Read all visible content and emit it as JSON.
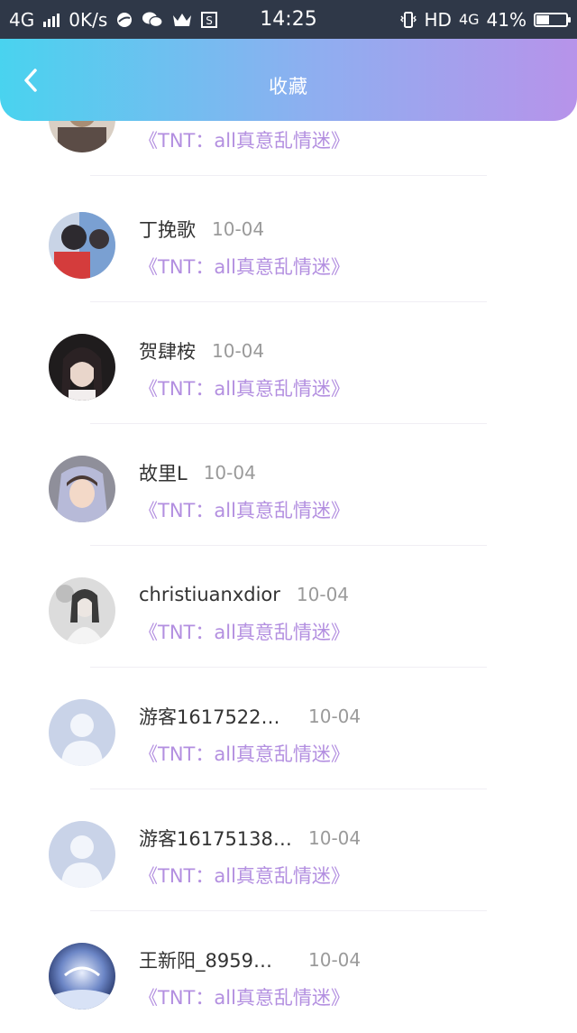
{
  "status_bar": {
    "network": "4G",
    "speed": "0K/s",
    "time": "14:25",
    "hd": "HD",
    "network_right": "4G",
    "battery": "41%",
    "battery_level": 0.41
  },
  "header": {
    "title": "收藏",
    "back_icon": "chevron-left-icon"
  },
  "colors": {
    "header_gradient": [
      "#49d3ef",
      "#8faef0",
      "#b793ea"
    ],
    "book_link": "#b38fe0",
    "name": "#333333",
    "date": "#9a9a9a"
  },
  "items": [
    {
      "name": "",
      "date": "",
      "book": "《TNT：all真意乱情迷》",
      "avatar": "photo-avatar"
    },
    {
      "name": "丁挽歌",
      "date": "10-04",
      "book": "《TNT：all真意乱情迷》",
      "avatar": "photo-avatar"
    },
    {
      "name": "贺肆桉",
      "date": "10-04",
      "book": "《TNT：all真意乱情迷》",
      "avatar": "photo-avatar"
    },
    {
      "name": "故里L",
      "date": "10-04",
      "book": "《TNT：all真意乱情迷》",
      "avatar": "photo-avatar"
    },
    {
      "name": "christiuanxdior",
      "date": "10-04",
      "book": "《TNT：all真意乱情迷》",
      "avatar": "photo-avatar"
    },
    {
      "name": "游客1617522…",
      "date": "10-04",
      "book": "《TNT：all真意乱情迷》",
      "avatar": "default-user-icon"
    },
    {
      "name": "游客16175138…",
      "date": "10-04",
      "book": "《TNT：all真意乱情迷》",
      "avatar": "default-user-icon"
    },
    {
      "name": "王新阳_8959…",
      "date": "10-04",
      "book": "《TNT：all真意乱情迷》",
      "avatar": "photo-avatar"
    }
  ]
}
